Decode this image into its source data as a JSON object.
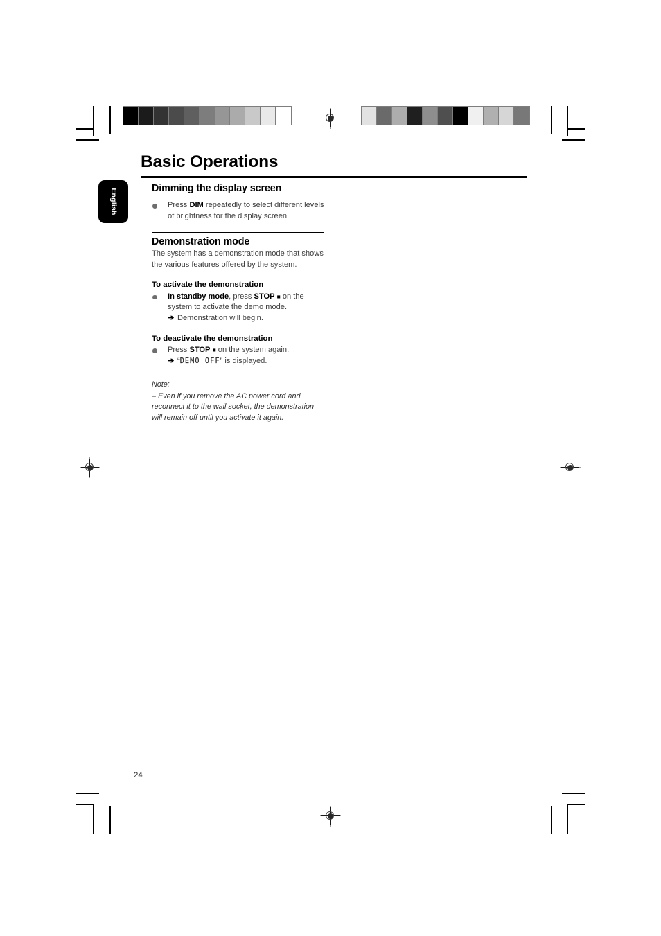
{
  "page": {
    "title": "Basic Operations",
    "language_tab": "English",
    "page_number": "24"
  },
  "print_marks": {
    "left_bar_label": "grayscale-calibration-bar",
    "right_bar_label": "grayscale-control-bar",
    "left_bar_swatches": [
      "#000000",
      "#1b1b1b",
      "#333333",
      "#4b4b4b",
      "#5f5f5f",
      "#7d7d7d",
      "#969696",
      "#ababab",
      "#c9c9c9",
      "#e9e9e9",
      "#ffffff"
    ],
    "right_bar_swatches": [
      "#e2e2e2",
      "#6a6a6a",
      "#adadad",
      "#1f1f1f",
      "#8e8e8e",
      "#4f4f4f",
      "#000000",
      "#f0f0f0",
      "#b0b0b0",
      "#d6d6d6",
      "#787878"
    ]
  },
  "sections": [
    {
      "id": "dimming",
      "heading": "Dimming the display screen",
      "bullets": [
        {
          "pre": "Press ",
          "bold": "DIM",
          "post": " repeatedly to select different levels of brightness for the display screen."
        }
      ]
    },
    {
      "id": "demonstration",
      "heading": "Demonstration mode",
      "intro": "The system has a demonstration mode that shows the various features offered by the system.",
      "activate": {
        "subhead": "To activate the demonstration",
        "bullet_bold_lead": "In standby mode",
        "bullet_mid": ", press ",
        "bullet_bold_key": "STOP",
        "bullet_key_icon": "■",
        "bullet_tail": " on the system to activate the demo mode.",
        "result_arrow": "➔",
        "result_text": "Demonstration will begin."
      },
      "deactivate": {
        "subhead": "To deactivate the demonstration",
        "bullet_pre": "Press ",
        "bullet_bold_key": "STOP",
        "bullet_key_icon": "■",
        "bullet_tail": " on the system again.",
        "result_arrow": "➔",
        "result_quote_open": "“",
        "result_lcd": "DEMO OFF",
        "result_quote_close": "”",
        "result_tail": " is displayed."
      }
    }
  ],
  "note": {
    "label": "Note:",
    "text": "–   Even if you remove the AC power cord and reconnect it to the wall socket, the demonstration will remain off until you activate it again."
  }
}
